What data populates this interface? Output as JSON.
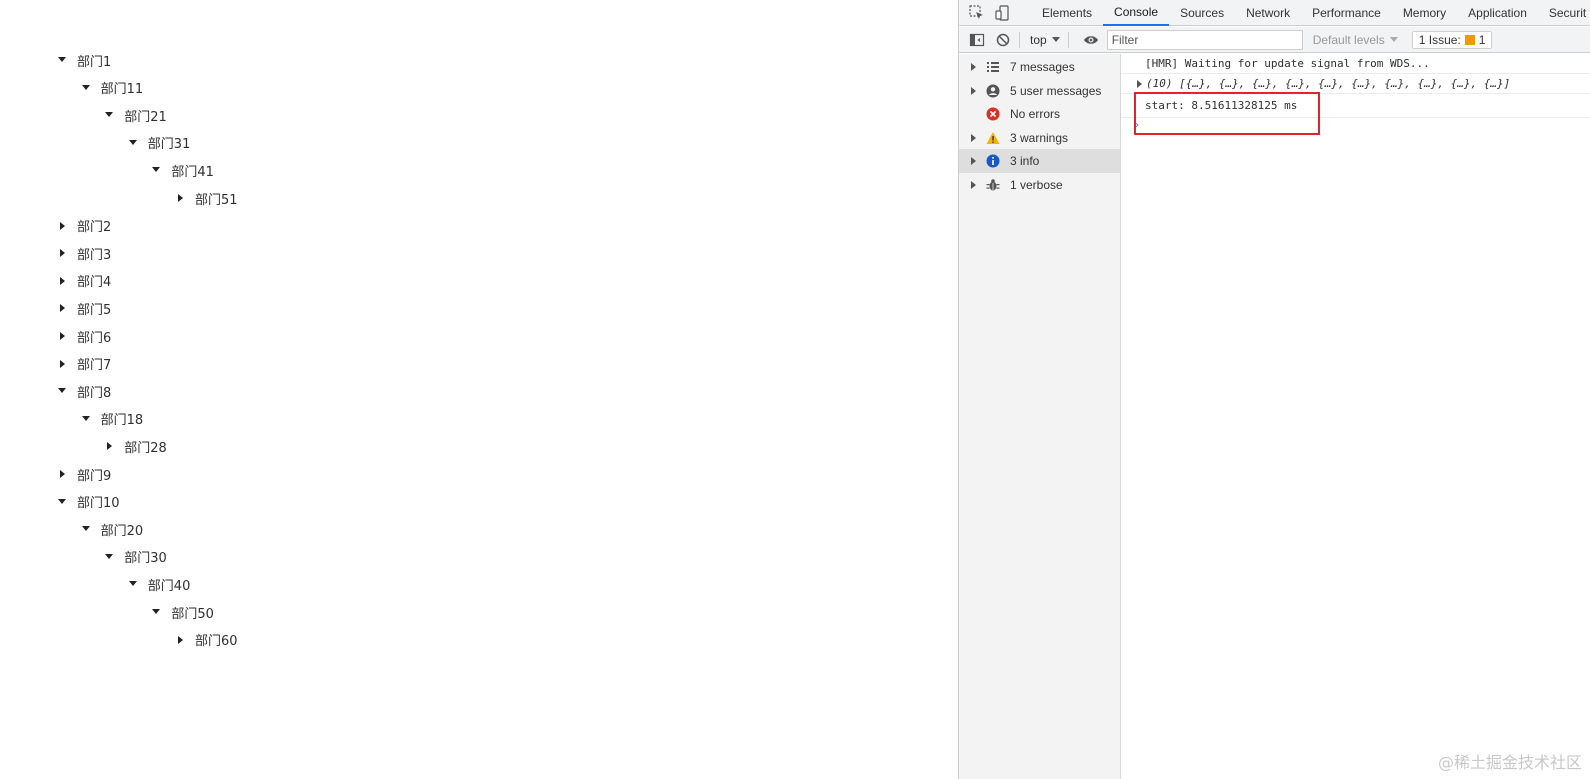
{
  "tree": [
    {
      "label": "部门1",
      "level": 0,
      "expanded": true
    },
    {
      "label": "部门11",
      "level": 1,
      "expanded": true
    },
    {
      "label": "部门21",
      "level": 2,
      "expanded": true
    },
    {
      "label": "部门31",
      "level": 3,
      "expanded": true
    },
    {
      "label": "部门41",
      "level": 4,
      "expanded": true
    },
    {
      "label": "部门51",
      "level": 5,
      "expanded": false
    },
    {
      "label": "部门2",
      "level": 0,
      "expanded": false
    },
    {
      "label": "部门3",
      "level": 0,
      "expanded": false
    },
    {
      "label": "部门4",
      "level": 0,
      "expanded": false
    },
    {
      "label": "部门5",
      "level": 0,
      "expanded": false
    },
    {
      "label": "部门6",
      "level": 0,
      "expanded": false
    },
    {
      "label": "部门7",
      "level": 0,
      "expanded": false
    },
    {
      "label": "部门8",
      "level": 0,
      "expanded": true
    },
    {
      "label": "部门18",
      "level": 1,
      "expanded": true
    },
    {
      "label": "部门28",
      "level": 2,
      "expanded": false
    },
    {
      "label": "部门9",
      "level": 0,
      "expanded": false
    },
    {
      "label": "部门10",
      "level": 0,
      "expanded": true
    },
    {
      "label": "部门20",
      "level": 1,
      "expanded": true
    },
    {
      "label": "部门30",
      "level": 2,
      "expanded": true
    },
    {
      "label": "部门40",
      "level": 3,
      "expanded": true
    },
    {
      "label": "部门50",
      "level": 4,
      "expanded": true
    },
    {
      "label": "部门60",
      "level": 5,
      "expanded": false
    }
  ],
  "devtools": {
    "tabs": [
      "Elements",
      "Console",
      "Sources",
      "Network",
      "Performance",
      "Memory",
      "Application",
      "Securit"
    ],
    "active_tab": "Console",
    "context": "top",
    "filter_placeholder": "Filter",
    "levels_label": "Default levels",
    "issues_prefix": "1 Issue:",
    "issues_count": "1",
    "sidebar": [
      {
        "label": "7 messages",
        "icon": "list-icon",
        "caret": true
      },
      {
        "label": "5 user messages",
        "icon": "user-icon",
        "caret": true
      },
      {
        "label": "No errors",
        "icon": "error-icon",
        "caret": false
      },
      {
        "label": "3 warnings",
        "icon": "warning-icon",
        "caret": true
      },
      {
        "label": "3 info",
        "icon": "info-icon",
        "caret": true,
        "selected": true
      },
      {
        "label": "1 verbose",
        "icon": "bug-icon",
        "caret": true
      }
    ],
    "console_lines": [
      "[HMR] Waiting for update signal from WDS...",
      "(10) [{…}, {…}, {…}, {…}, {…}, {…}, {…}, {…}, {…}, {…}]",
      "start: 8.51611328125 ms"
    ]
  },
  "watermark": "@稀土掘金技术社区",
  "colors": {
    "accent": "#1a73e8",
    "highlight": "#e3222b",
    "warning": "#f29900",
    "error": "#d93025",
    "info": "#1a73e8"
  }
}
